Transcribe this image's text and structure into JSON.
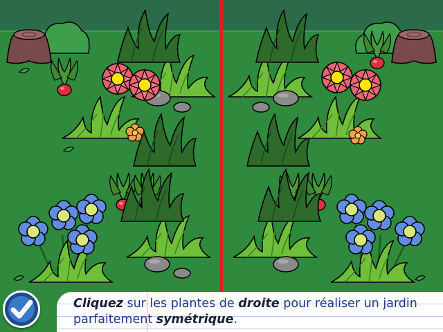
{
  "instruction": {
    "w1": "Cliquez",
    "w2": " sur les plantes de ",
    "w3": "droite",
    "w4": " pour réaliser un jardin parfaitement ",
    "w5": "symétrique",
    "w6": "."
  },
  "check_button": {
    "icon": "checkmark-icon"
  },
  "colors": {
    "sky": "#2c6b4a",
    "grass": "#2f8a3e",
    "divider": "#e02020",
    "flower_pink": "#e8646e",
    "flower_center": "#ffe600",
    "flower_blue": "#5f8ee0",
    "flower_blue_center": "#d8e67a",
    "bush_light": "#6fbf3a",
    "bush_dark": "#2e6a2a",
    "stone": "#8a8a8a",
    "stump": "#7a4a4a"
  }
}
